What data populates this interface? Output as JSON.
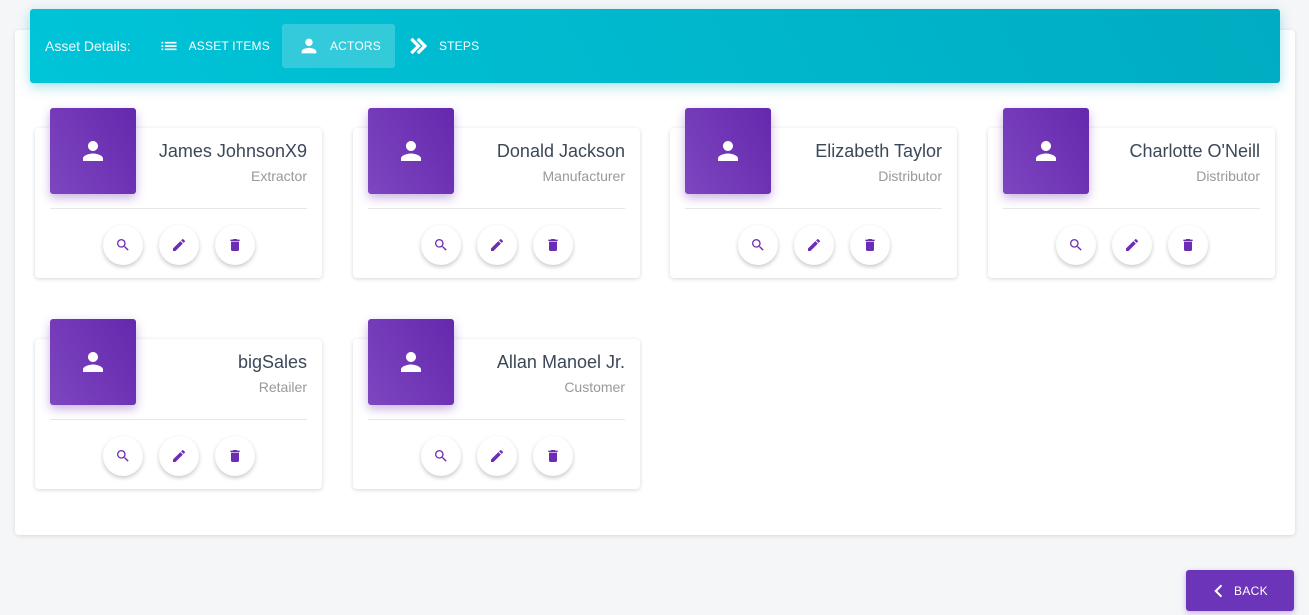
{
  "tabs": {
    "caption": "Asset Details:",
    "items": [
      {
        "label": "ASSET ITEMS",
        "icon": "list-icon",
        "active": false
      },
      {
        "label": "ACTORS",
        "icon": "person-icon",
        "active": true
      },
      {
        "label": "STEPS",
        "icon": "double-chevron-right-icon",
        "active": false
      }
    ]
  },
  "actors": [
    {
      "name": "James JohnsonX9",
      "role": "Extractor"
    },
    {
      "name": "Donald Jackson",
      "role": "Manufacturer"
    },
    {
      "name": "Elizabeth Taylor",
      "role": "Distributor"
    },
    {
      "name": "Charlotte O'Neill",
      "role": "Distributor"
    },
    {
      "name": "bigSales",
      "role": "Retailer"
    },
    {
      "name": "Allan Manoel Jr.",
      "role": "Customer"
    }
  ],
  "card_actions": [
    "search-icon",
    "edit-icon",
    "delete-icon"
  ],
  "footer": {
    "back_label": "BACK"
  },
  "colors": {
    "tab_bar": "#00bcd4",
    "accent_purple": "#6c34b8",
    "action_icon": "#6a2db3"
  }
}
